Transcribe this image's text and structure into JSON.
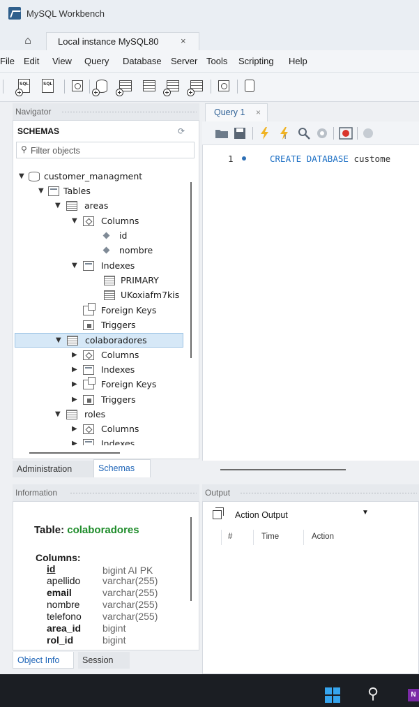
{
  "app": {
    "title": "MySQL Workbench"
  },
  "tabs": {
    "connection_tab": "Local instance MySQL80",
    "close_glyph": "×"
  },
  "menu": [
    "File",
    "Edit",
    "View",
    "Query",
    "Database",
    "Server",
    "Tools",
    "Scripting",
    "Help"
  ],
  "navigator": {
    "title": "Navigator",
    "schemas_label": "SCHEMAS",
    "filter_placeholder": "Filter objects",
    "tree": {
      "schema": "customer_managment",
      "tables_label": "Tables",
      "areas": {
        "name": "areas",
        "columns_label": "Columns",
        "columns": [
          "id",
          "nombre"
        ],
        "indexes_label": "Indexes",
        "indexes": [
          "PRIMARY",
          "UKoxiafm7kis"
        ],
        "fk_label": "Foreign Keys",
        "triggers_label": "Triggers"
      },
      "colaboradores": {
        "name": "colaboradores",
        "columns_label": "Columns",
        "indexes_label": "Indexes",
        "fk_label": "Foreign Keys",
        "triggers_label": "Triggers"
      },
      "roles": {
        "name": "roles",
        "columns_label": "Columns",
        "indexes_label": "Indexes"
      }
    }
  },
  "bottom_tabs": {
    "administration": "Administration",
    "schemas": "Schemas"
  },
  "information": {
    "title": "Information",
    "table_prefix": "Table: ",
    "table_name": "colaboradores",
    "columns_label": "Columns:",
    "columns": [
      {
        "name": "id",
        "type": "bigint AI PK"
      },
      {
        "name": "apellido",
        "type": "varchar(255)"
      },
      {
        "name": "email",
        "type": "varchar(255)"
      },
      {
        "name": "nombre",
        "type": "varchar(255)"
      },
      {
        "name": "telefono",
        "type": "varchar(255)"
      },
      {
        "name": "area_id",
        "type": "bigint"
      },
      {
        "name": "rol_id",
        "type": "bigint"
      }
    ]
  },
  "info_tabs": {
    "object_info": "Object Info",
    "session": "Session"
  },
  "editor": {
    "tab_label": "Query 1",
    "close_glyph": "×",
    "line_number": "1",
    "code_kw1": "CREATE",
    "code_kw2": "DATABASE",
    "code_ident": "custome"
  },
  "output": {
    "title": "Output",
    "selector": "Action Output",
    "columns": [
      "#",
      "Time",
      "Action"
    ]
  },
  "colors": {
    "accent": "#2066b8",
    "table_name_green": "#1e8c2a",
    "sql_keyword": "#1c6fc4",
    "selection": "#d6e8f7",
    "taskbar": "#1b1e23"
  },
  "icons": [
    "home-icon",
    "new-sql-tab-icon",
    "open-sql-script-icon",
    "schema-icon",
    "table-icon",
    "view-icon",
    "search-icon",
    "reconnect-icon",
    "refresh-icon",
    "execute-icon",
    "stop-icon",
    "save-icon",
    "folder-icon",
    "windows-start-icon",
    "onenote-icon"
  ]
}
